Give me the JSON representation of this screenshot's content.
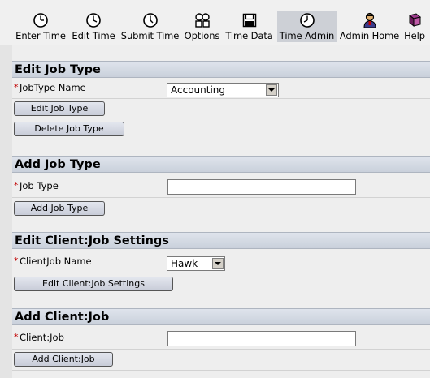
{
  "toolbar": {
    "items": [
      {
        "label": "Enter Time",
        "icon": "clock-icon"
      },
      {
        "label": "Edit Time",
        "icon": "clock-icon"
      },
      {
        "label": "Submit Time",
        "icon": "clock-icon"
      },
      {
        "label": "Options",
        "icon": "options-icon"
      },
      {
        "label": "Time Data",
        "icon": "floppy-disk-icon"
      },
      {
        "label": "Time Admin",
        "icon": "clock-icon"
      },
      {
        "label": "Admin Home",
        "icon": "admin-person-icon"
      },
      {
        "label": "Help",
        "icon": "help-book-icon"
      }
    ],
    "active": "Time Admin"
  },
  "sections": {
    "edit_job_type": {
      "title": "Edit Job Type",
      "field_label": "JobType Name",
      "selected": "Accounting",
      "edit_button": "Edit Job Type",
      "delete_button": "Delete Job Type"
    },
    "add_job_type": {
      "title": "Add Job Type",
      "field_label": "Job Type",
      "value": "",
      "add_button": "Add Job Type"
    },
    "edit_client_job": {
      "title": "Edit Client:Job Settings",
      "field_label": "ClientJob Name",
      "selected": "Hawk",
      "edit_button": "Edit Client:Job Settings"
    },
    "add_client_job": {
      "title": "Add Client:Job",
      "field_label": "Client:Job",
      "value": "",
      "add_button": "Add Client:Job"
    }
  },
  "required_marker": "*",
  "colors": {
    "required": "#c00000",
    "section_header": "#c9d0db",
    "active_tab": "#cdd0d6"
  }
}
